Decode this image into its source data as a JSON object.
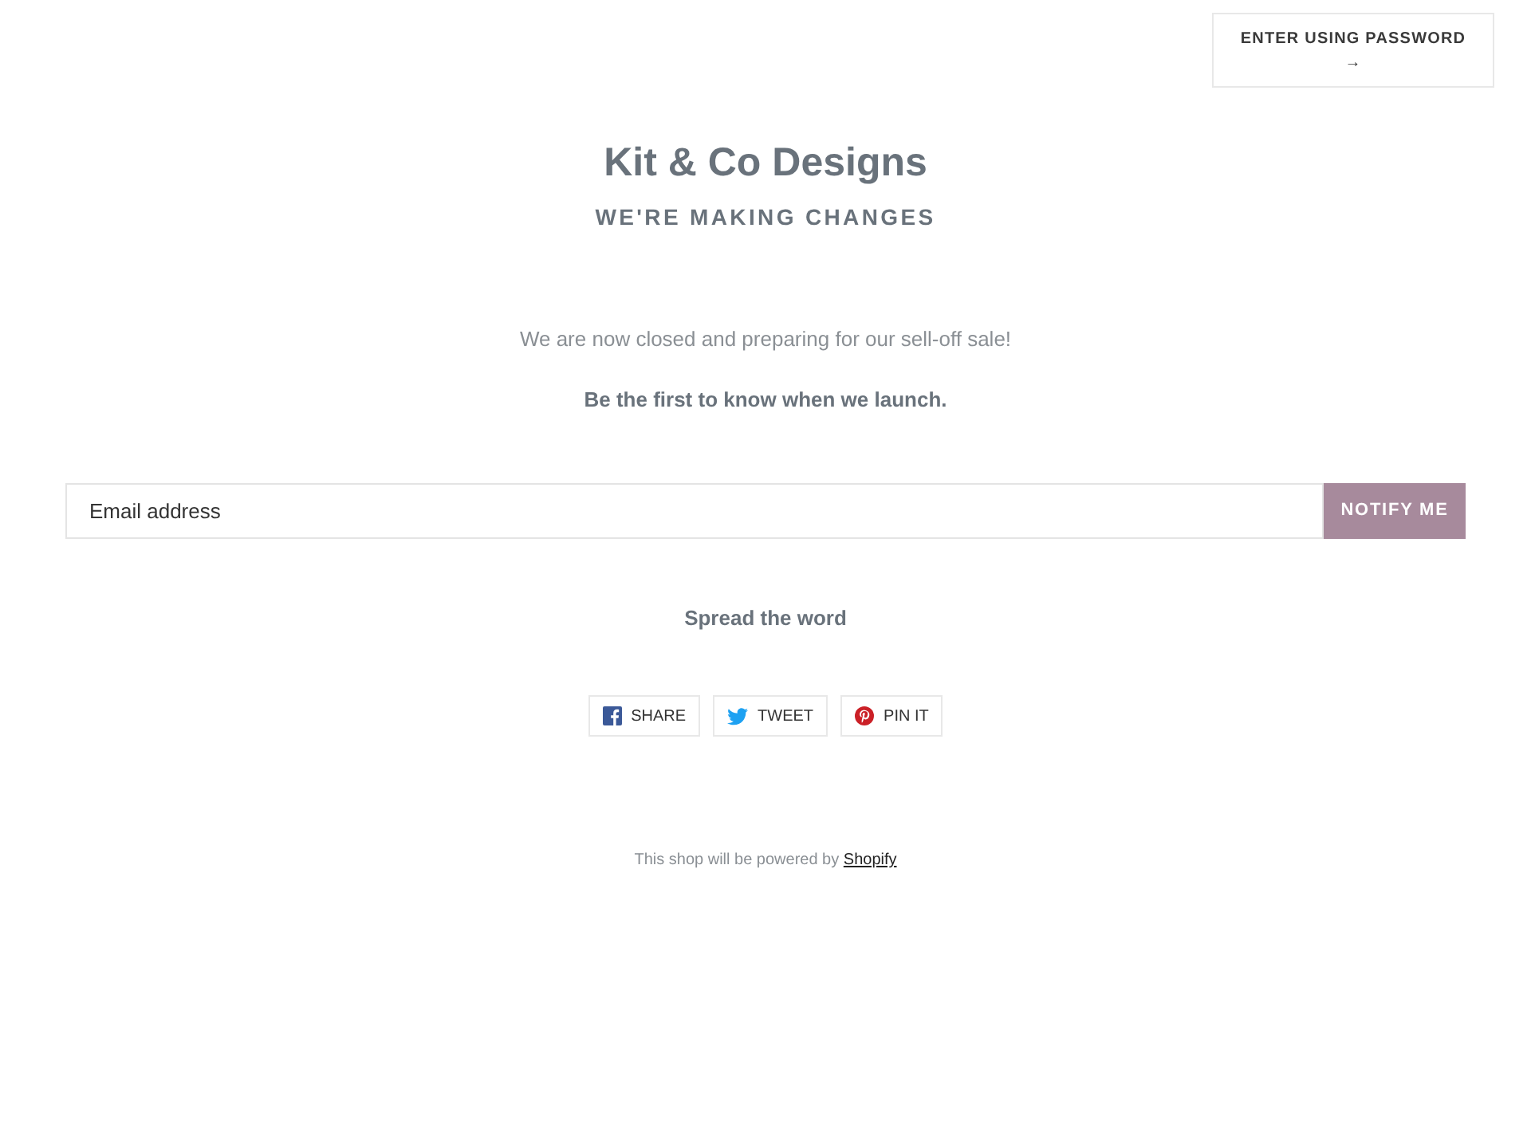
{
  "header": {
    "password_button": {
      "label": "ENTER USING PASSWORD",
      "arrow": "→"
    }
  },
  "title": "Kit & Co Designs",
  "subtitle": "WE'RE MAKING CHANGES",
  "message": "We are now closed and preparing for our sell-off sale!",
  "call_to_action": "Be the first to know when we launch.",
  "signup_form": {
    "placeholder": "Email address",
    "button": "NOTIFY ME"
  },
  "share": {
    "heading": "Spread the word",
    "buttons": [
      {
        "kind": "facebook",
        "label": "SHARE"
      },
      {
        "kind": "twitter",
        "label": "TWEET"
      },
      {
        "kind": "pinterest",
        "label": "PIN IT"
      }
    ]
  },
  "footer": {
    "text": "This shop will be powered by",
    "link": "Shopify"
  }
}
